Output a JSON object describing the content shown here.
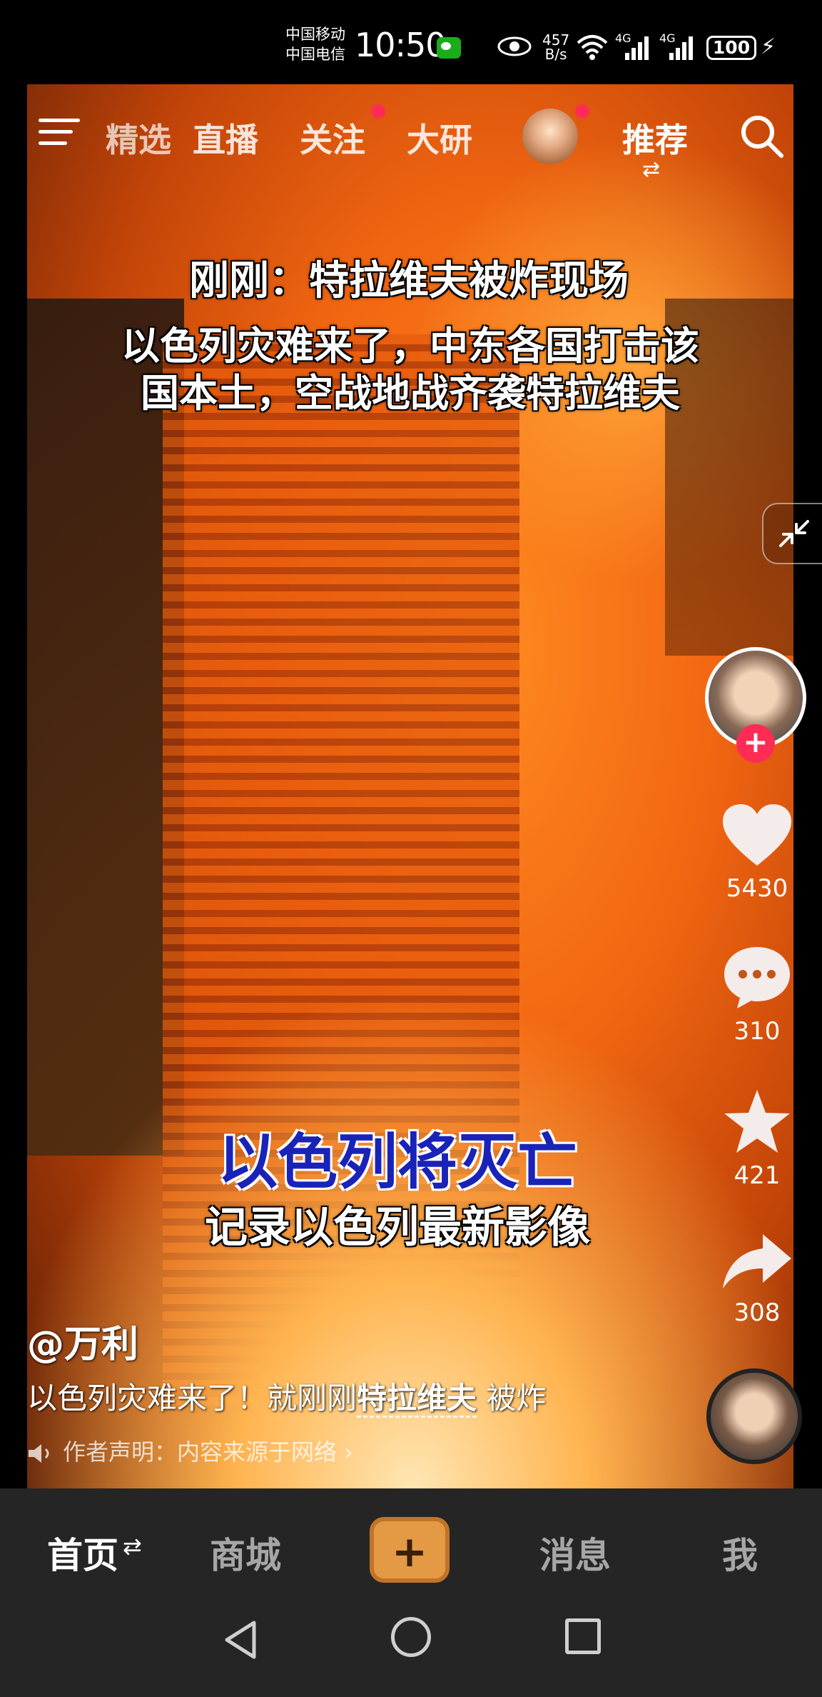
{
  "status_bar": {
    "carrier_1": "中国移动",
    "carrier_2": "中国电信",
    "time": "10:50",
    "net_speed_value": "457",
    "net_speed_unit": "B/s",
    "signal_1_label": "4G",
    "signal_2_label": "4G",
    "battery": "100"
  },
  "top_nav": {
    "tabs": [
      "精选",
      "直播",
      "关注",
      "大研",
      "推荐"
    ],
    "active_tab": "推荐"
  },
  "video": {
    "headline_1": "刚刚：特拉维夫被炸现场",
    "headline_2_line1": "以色列灾难来了，中东各国打击该",
    "headline_2_line2": "国本土，空战地战齐袭特拉维夫",
    "headline_3": "以色列将灭亡",
    "headline_4": "记录以色列最新影像"
  },
  "actions": {
    "likes": "5430",
    "comments": "310",
    "favorites": "421",
    "shares": "308"
  },
  "post": {
    "author": "@万利",
    "caption_prefix": "以色列灾难来了！就刚刚",
    "caption_highlight": "特拉维夫",
    "caption_suffix": " 被炸",
    "statement": "作者声明：内容来源于网络 ›"
  },
  "bottom_bar": {
    "home": "首页",
    "home_switch": "⇄",
    "mall": "商城",
    "create": "+",
    "messages": "消息",
    "me": "我"
  },
  "colors": {
    "accent_red": "#fe2c55",
    "create_button": "#e49944",
    "bottom_bar_bg": "#252525"
  }
}
